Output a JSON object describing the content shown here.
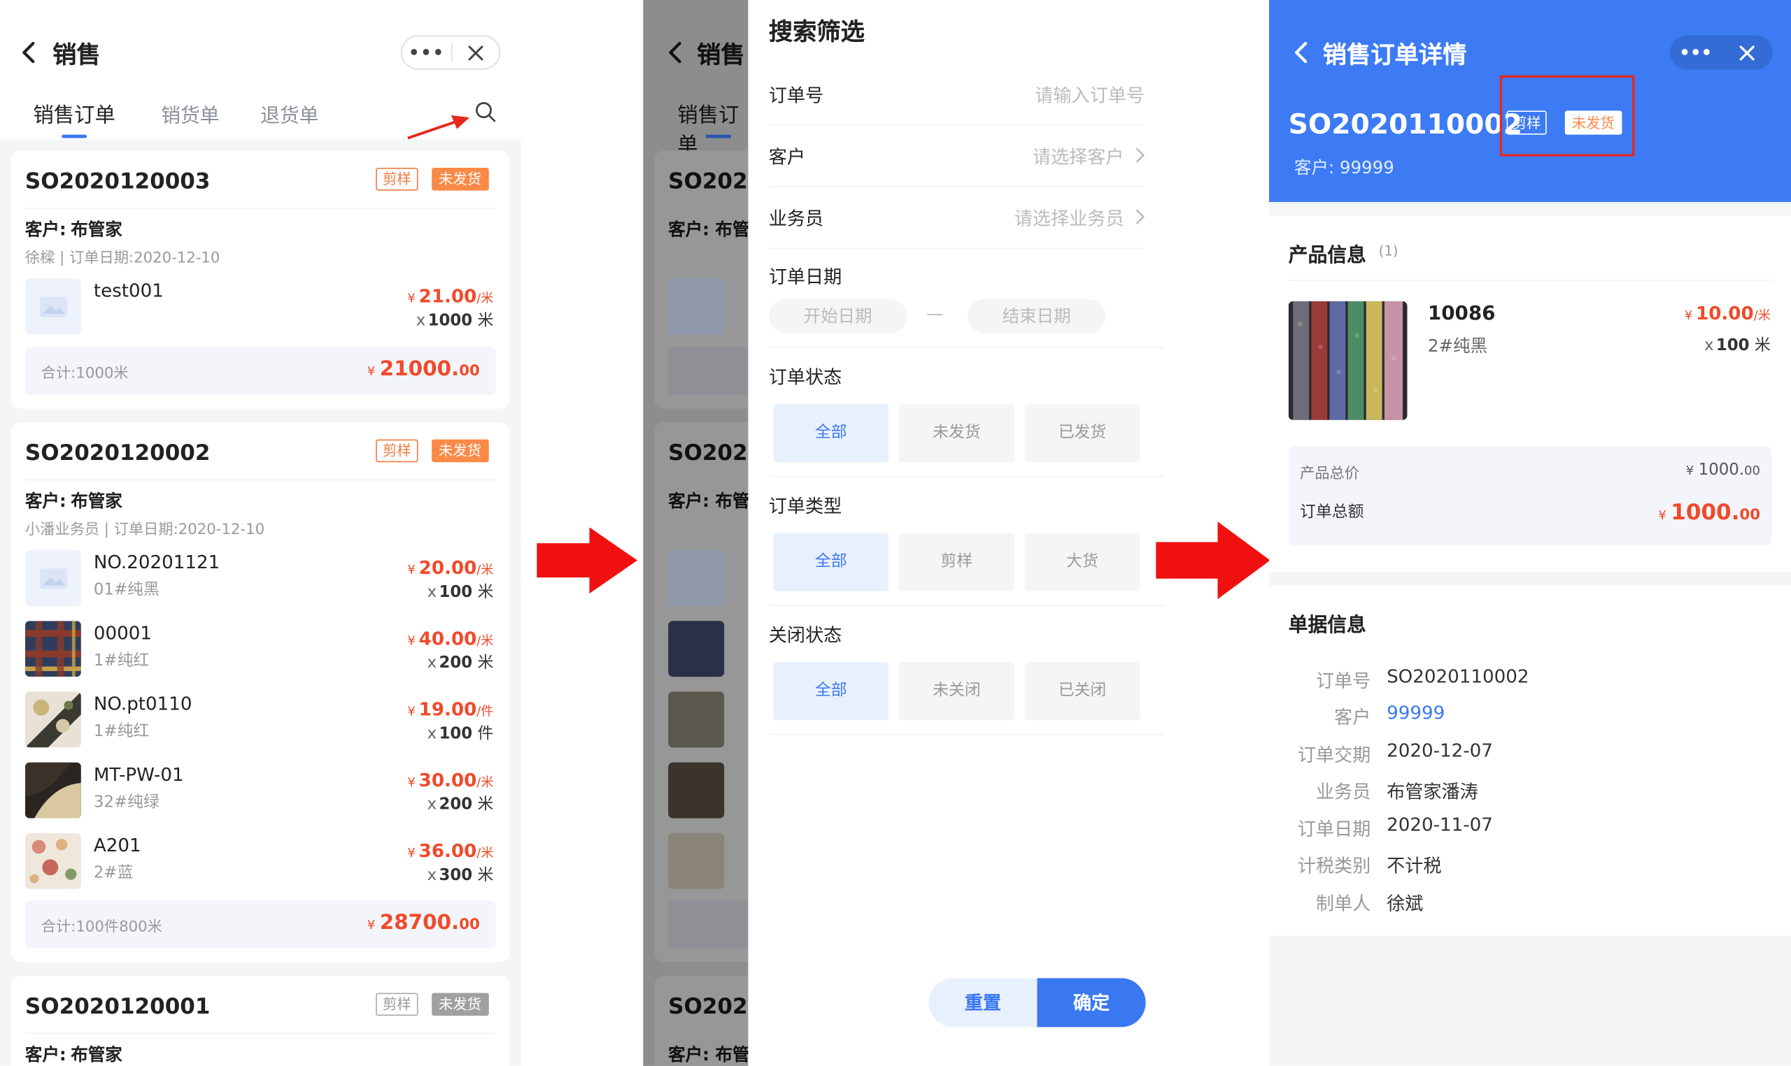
{
  "panel1": {
    "title": "销售",
    "tabs": [
      "销售订单",
      "销货单",
      "退货单"
    ],
    "orders": [
      {
        "order_no": "SO2020120003",
        "tag1": "剪样",
        "tag2": "未发货",
        "customer_label": "客户:",
        "customer": "布管家",
        "meta": "徐樑  |  订单日期:2020-12-10",
        "items": [
          {
            "name": "test001",
            "sub": "",
            "price_cur": "¥",
            "price": "21.00",
            "unit": "/米",
            "qty_x": "x",
            "qty": "1000",
            "qty_unit": "米"
          }
        ],
        "total_label": "合计:1000米",
        "total_cur": "¥",
        "total_int": "21000.",
        "total_dec": "00"
      },
      {
        "order_no": "SO2020120002",
        "tag1": "剪样",
        "tag2": "未发货",
        "customer_label": "客户:",
        "customer": "布管家",
        "meta": "小潘业务员  |  订单日期:2020-12-10",
        "items": [
          {
            "name": "NO.20201121",
            "sub": "01#纯黑",
            "price_cur": "¥",
            "price": "20.00",
            "unit": "/米",
            "qty_x": "x",
            "qty": "100",
            "qty_unit": "米"
          },
          {
            "name": "00001",
            "sub": "1#纯红",
            "price_cur": "¥",
            "price": "40.00",
            "unit": "/米",
            "qty_x": "x",
            "qty": "200",
            "qty_unit": "米"
          },
          {
            "name": "NO.pt0110",
            "sub": "1#纯红",
            "price_cur": "¥",
            "price": "19.00",
            "unit": "/件",
            "qty_x": "x",
            "qty": "100",
            "qty_unit": "件"
          },
          {
            "name": "MT-PW-01",
            "sub": "32#纯绿",
            "price_cur": "¥",
            "price": "30.00",
            "unit": "/米",
            "qty_x": "x",
            "qty": "200",
            "qty_unit": "米"
          },
          {
            "name": "A201",
            "sub": "2#蓝",
            "price_cur": "¥",
            "price": "36.00",
            "unit": "/米",
            "qty_x": "x",
            "qty": "300",
            "qty_unit": "米"
          }
        ],
        "total_label": "合计:100件800米",
        "total_cur": "¥",
        "total_int": "28700.",
        "total_dec": "00"
      },
      {
        "order_no": "SO2020120001",
        "tag1": "剪样",
        "tag2": "未发货",
        "customer_label": "客户:",
        "customer": "布管家"
      }
    ]
  },
  "panel2": {
    "under_title": "销售",
    "under_tab": "销售订单",
    "under_orders": [
      "SO2020",
      "SO2020",
      "SO2020"
    ],
    "under_cust": "客户: 布管",
    "sheet_title": "搜索筛选",
    "fields": [
      {
        "label": "订单号",
        "placeholder": "请输入订单号"
      },
      {
        "label": "客户",
        "placeholder": "请选择客户"
      },
      {
        "label": "业务员",
        "placeholder": "请选择业务员"
      }
    ],
    "date_label": "订单日期",
    "date_start": "开始日期",
    "date_sep": "—",
    "date_end": "结束日期",
    "groups": [
      {
        "title": "订单状态",
        "options": [
          "全部",
          "未发货",
          "已发货"
        ],
        "selected": 0
      },
      {
        "title": "订单类型",
        "options": [
          "全部",
          "剪样",
          "大货"
        ],
        "selected": 0
      },
      {
        "title": "关闭状态",
        "options": [
          "全部",
          "未关闭",
          "已关闭"
        ],
        "selected": 0
      }
    ],
    "reset_label": "重置",
    "confirm_label": "确定"
  },
  "panel3": {
    "title": "销售订单详情",
    "order_no": "SO2020110002",
    "tag1": "剪样",
    "tag2": "未发货",
    "customer_line": "客户: 99999",
    "product_section": "产品信息",
    "product_count": "(1)",
    "product": {
      "code": "10086",
      "color": "2#纯黑",
      "price_cur": "¥",
      "price": "10.00",
      "unit": "/米",
      "qty_x": "x",
      "qty": "100",
      "qty_unit": "米"
    },
    "total_label": "产品总价",
    "total_cur": "¥",
    "total_value": "1000.",
    "total_dec": "00",
    "order_total_label": "订单总额",
    "order_total_cur": "¥",
    "order_total_value": "1000.",
    "order_total_dec": "00",
    "doc_section": "单据信息",
    "doc": [
      {
        "k": "订单号",
        "v": "SO2020110002"
      },
      {
        "k": "客户",
        "v": "99999"
      },
      {
        "k": "订单交期",
        "v": "2020-12-07"
      },
      {
        "k": "业务员",
        "v": "布管家潘涛"
      },
      {
        "k": "订单日期",
        "v": "2020-11-07"
      },
      {
        "k": "计税类别",
        "v": "不计税"
      },
      {
        "k": "制单人",
        "v": "徐斌"
      }
    ]
  },
  "colors": {
    "accent": "#3a78f2",
    "header_blue": "#3c7bf4",
    "price_red": "#f04a2a",
    "tag_orange": "#fa8a47",
    "annotation_red": "#e8261e"
  }
}
